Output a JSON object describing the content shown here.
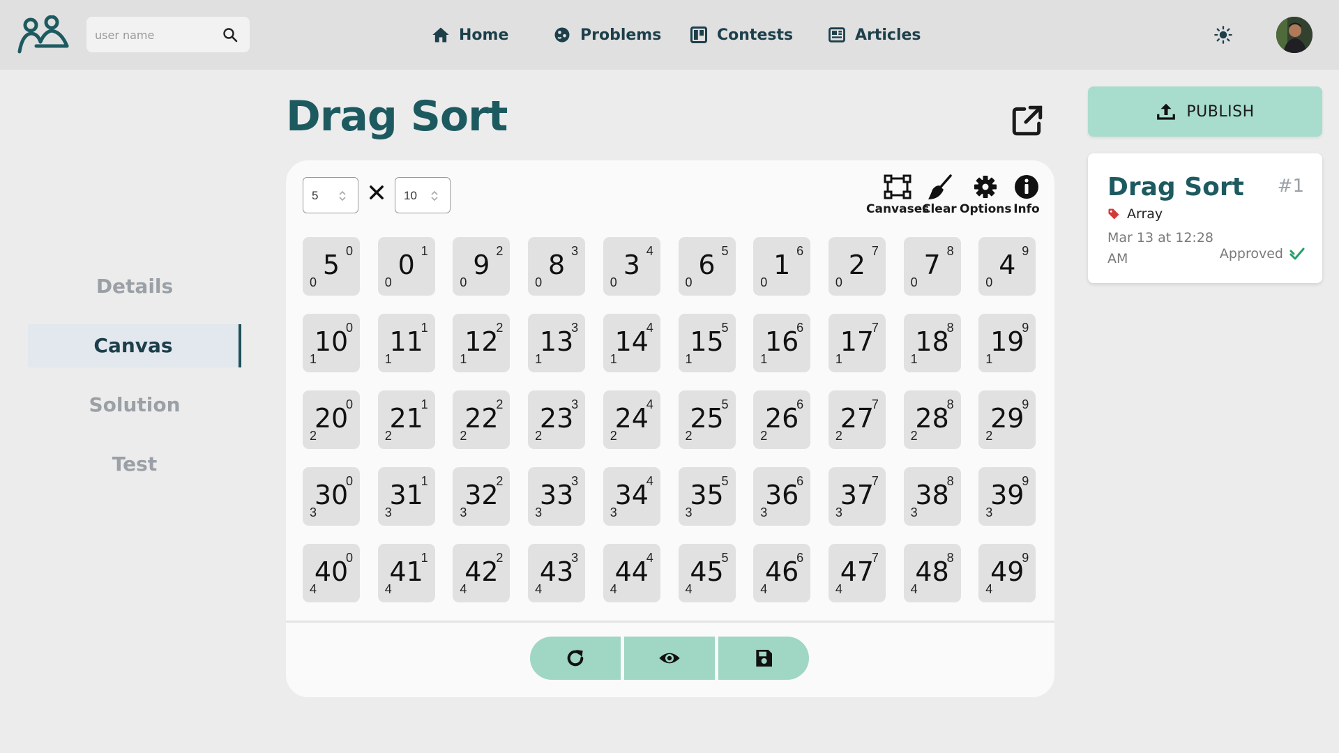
{
  "header": {
    "search_placeholder": "user name",
    "nav": [
      {
        "label": "Home",
        "icon": "home-icon"
      },
      {
        "label": "Problems",
        "icon": "puzzle-icon"
      },
      {
        "label": "Contests",
        "icon": "board-icon"
      },
      {
        "label": "Articles",
        "icon": "newspaper-icon"
      }
    ]
  },
  "sidebar": {
    "items": [
      {
        "label": "Details"
      },
      {
        "label": "Canvas"
      },
      {
        "label": "Solution"
      },
      {
        "label": "Test"
      }
    ]
  },
  "main": {
    "title": "Drag Sort",
    "rows_value": "5",
    "cols_value": "10",
    "tools": [
      {
        "label": "Canvases",
        "icon": "canvases-icon"
      },
      {
        "label": "Clear",
        "icon": "broom-icon"
      },
      {
        "label": "Options",
        "icon": "gear-icon"
      },
      {
        "label": "Info",
        "icon": "info-icon"
      }
    ],
    "grid": [
      [
        5,
        0,
        9,
        8,
        3,
        6,
        1,
        2,
        7,
        4
      ],
      [
        10,
        11,
        12,
        13,
        14,
        15,
        16,
        17,
        18,
        19
      ],
      [
        20,
        21,
        22,
        23,
        24,
        25,
        26,
        27,
        28,
        29
      ],
      [
        30,
        31,
        32,
        33,
        34,
        35,
        36,
        37,
        38,
        39
      ],
      [
        40,
        41,
        42,
        43,
        44,
        45,
        46,
        47,
        48,
        49
      ]
    ],
    "actions": [
      "refresh-icon",
      "eye-icon",
      "save-icon"
    ]
  },
  "right": {
    "publish_label": "PUBLISH",
    "card": {
      "title": "Drag Sort",
      "number": "#1",
      "tag": "Array",
      "date": "Mar 13 at 12:28 AM",
      "status": "Approved"
    }
  },
  "colors": {
    "brand": "#1d5a60",
    "accent": "#9fd6c4",
    "publish": "#a8dccc",
    "tag_red": "#d23a3a",
    "approved_green": "#22a06b"
  }
}
